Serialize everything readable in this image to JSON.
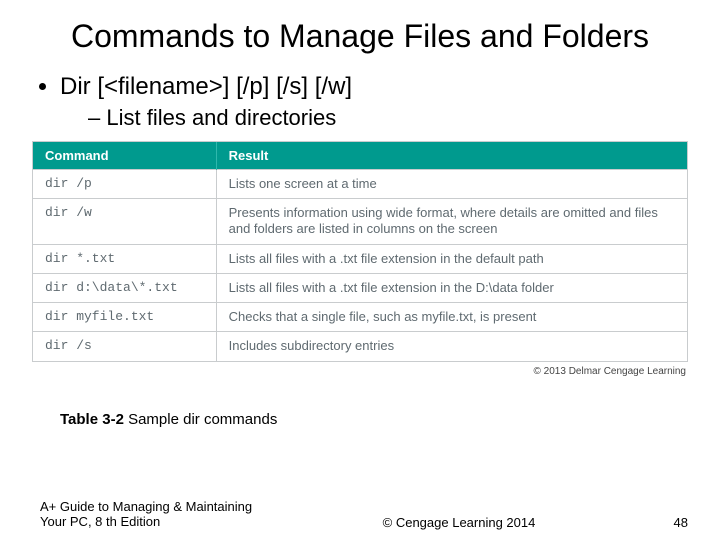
{
  "title": "Commands to Manage Files and Folders",
  "bullet": "Dir [<filename>] [/p] [/s] [/w]",
  "subbullet": "List files and directories",
  "table": {
    "headers": {
      "cmd": "Command",
      "res": "Result"
    },
    "rows": [
      {
        "cmd": "dir /p",
        "res": "Lists one screen at a time"
      },
      {
        "cmd": "dir /w",
        "res": "Presents information using wide format, where details are omitted and files and folders are listed in columns on the screen"
      },
      {
        "cmd": "dir *.txt",
        "res": "Lists all files with a .txt file extension in the default path"
      },
      {
        "cmd": "dir d:\\data\\*.txt",
        "res": "Lists all files with a .txt file extension in the D:\\data folder"
      },
      {
        "cmd": "dir myfile.txt",
        "res": "Checks that a single file, such as myfile.txt, is present"
      },
      {
        "cmd": "dir /s",
        "res": "Includes subdirectory entries"
      }
    ],
    "credit": "© 2013 Delmar Cengage Learning"
  },
  "caption": {
    "num": "Table 3-2",
    "text": "  Sample dir commands"
  },
  "footer": {
    "left": "A+ Guide to Managing & Maintaining Your PC, 8 th Edition",
    "center": "© Cengage Learning  2014",
    "right": "48"
  }
}
